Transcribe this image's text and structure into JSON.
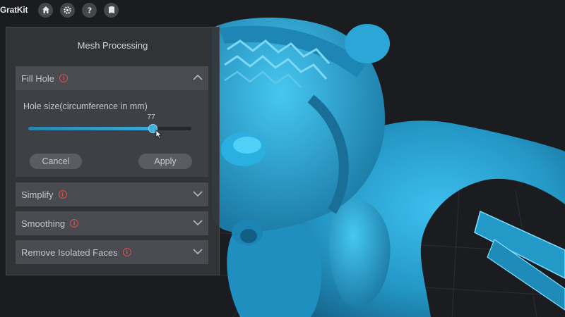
{
  "app": {
    "logo_text": "GratKit"
  },
  "toolbar": {
    "buttons": [
      "home-icon",
      "settings-icon",
      "help-icon",
      "book-icon"
    ]
  },
  "panel": {
    "title": "Mesh Processing",
    "sections": {
      "fill_hole": {
        "label": "Fill Hole",
        "expanded": true,
        "hole_size_label": "Hole size(circumference in mm)",
        "slider_value": "77",
        "slider_fraction": 0.76,
        "cancel_label": "Cancel",
        "apply_label": "Apply"
      },
      "simplify": {
        "label": "Simplify",
        "expanded": false
      },
      "smoothing": {
        "label": "Smoothing",
        "expanded": false
      },
      "remove_isolated": {
        "label": "Remove Isolated Faces",
        "expanded": false
      }
    },
    "info_glyph": "i"
  },
  "colors": {
    "model": "#2aa4d2",
    "accent": "#3fb2e0",
    "info": "#d9534f",
    "panel": "#343539"
  }
}
